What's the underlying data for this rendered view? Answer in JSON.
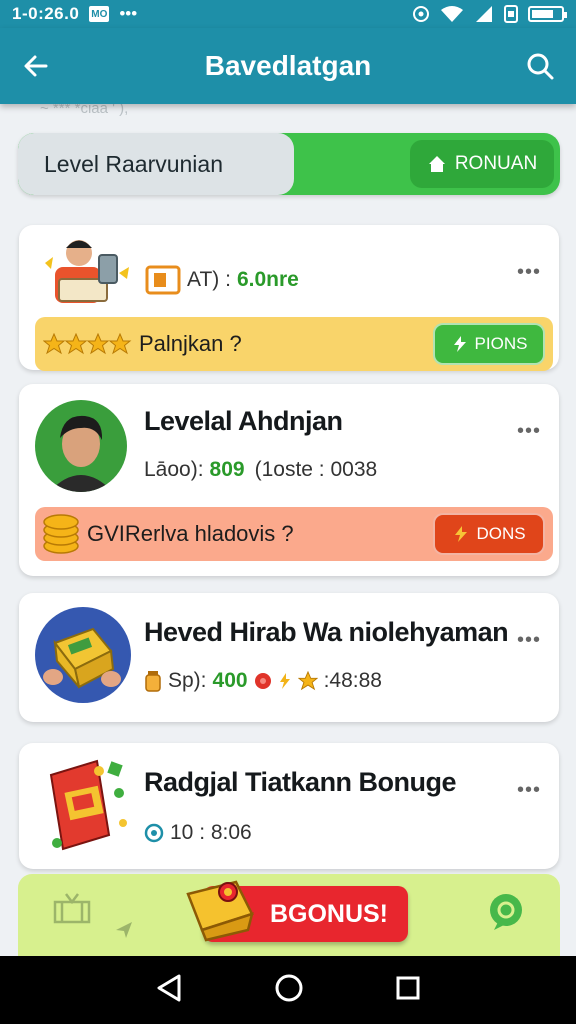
{
  "status_bar": {
    "time": "1-0:26.0",
    "box_icon_text": "MO",
    "dots": "•••",
    "battery_level": 0.75
  },
  "app_bar": {
    "title": "Bavedlatgan",
    "back_icon": "arrow-left-icon",
    "search_icon": "search-icon"
  },
  "faded_subtitle": "~ *** *ciaa ' ),",
  "level_bar": {
    "label": "Level Raarvunian",
    "button_label": "RONUAN",
    "progress": 0.51
  },
  "cards": [
    {
      "stats_label": "AT) :",
      "stats_value": "6.0nre",
      "more": "•••",
      "banner_text": "Palnjkan ?",
      "banner_button": "PIONS",
      "banner_color": "#f9d46a",
      "button_color": "#3fb83f"
    },
    {
      "title": "Levelal Ahdnjan",
      "stats_label": "Lāoo):",
      "stats_value": "809",
      "stats_suffix": "(1oste : 0038",
      "more": "•••",
      "banner_text": "GVIRerlva hladovis ?",
      "banner_button": "DONS",
      "banner_color": "#fba98c",
      "button_color": "#e0451a"
    },
    {
      "title": "Heved Hirab Wa niolehyaman",
      "stats_label": "Sp):",
      "stats_value": "400",
      "stats_suffix": ":48:88",
      "more": "•••"
    },
    {
      "title": "Radgjal Tiatkann Bonuge",
      "stats_value": "10 : 8:06",
      "more": "•••"
    }
  ],
  "promo": {
    "button_label": "BGONUS!"
  },
  "colors": {
    "primary": "#1e8fa8",
    "green": "#3ec24a",
    "promo_bg": "#d7f08e",
    "promo_button": "#e8262e"
  }
}
